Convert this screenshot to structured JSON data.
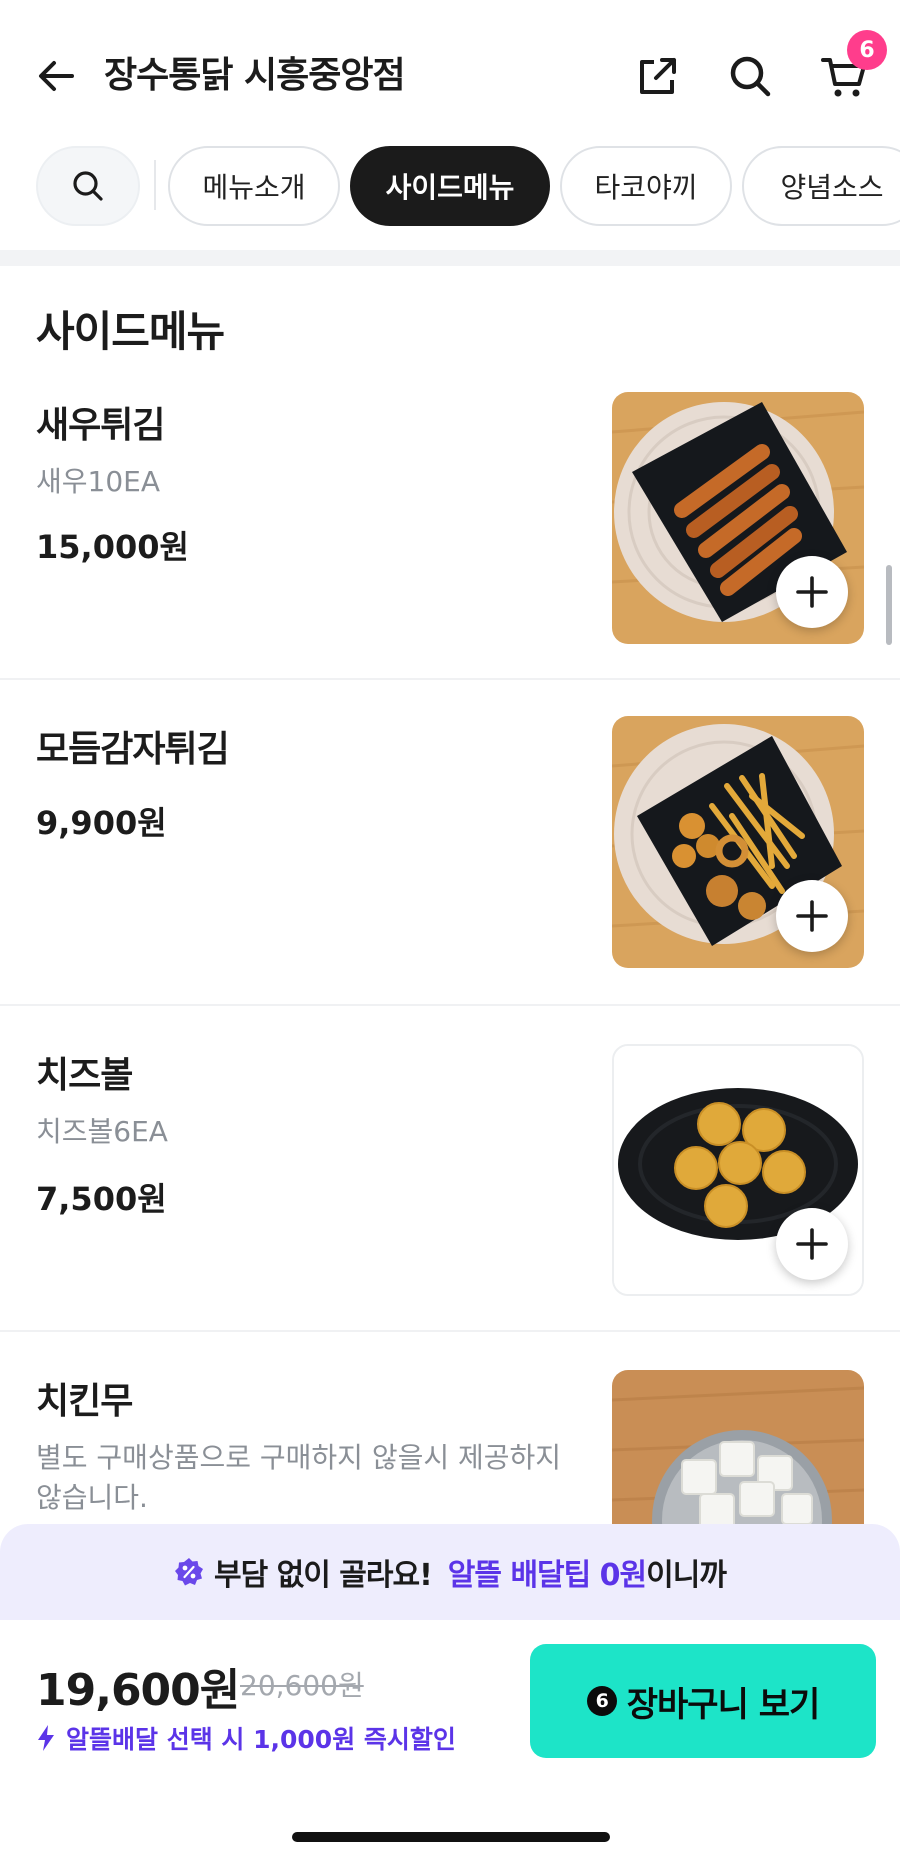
{
  "header": {
    "store_name": "장수통닭 시흥중앙점",
    "cart_count": "6"
  },
  "tabs": [
    {
      "label": "메뉴소개",
      "active": false
    },
    {
      "label": "사이드메뉴",
      "active": true
    },
    {
      "label": "타코야끼",
      "active": false
    },
    {
      "label": "양념소스",
      "active": false
    }
  ],
  "section": {
    "title": "사이드메뉴"
  },
  "items": [
    {
      "name": "새우튀김",
      "desc": "새우10EA",
      "price": "15,000원",
      "image": "fried-shrimp-photo"
    },
    {
      "name": "모듬감자튀김",
      "desc": "",
      "price": "9,900원",
      "image": "assorted-fries-photo"
    },
    {
      "name": "치즈볼",
      "desc": "치즈볼6EA",
      "price": "7,500원",
      "image": "cheese-balls-photo"
    },
    {
      "name": "치킨무",
      "desc": "별도 구매상품으로 구매하지 않을시  제공하지 않습니다.",
      "price": "",
      "image": "chicken-radish-photo"
    }
  ],
  "promo": {
    "text": "부담 없이 골라요!",
    "highlight": "알뜰 배달팁 0원",
    "suffix": "이니까"
  },
  "order": {
    "total": "19,600원",
    "original": "20,600원",
    "discount_text": "알뜰배달 선택 시 1,000원 즉시할인",
    "cta_label": "장바구니 보기",
    "cta_count": "6"
  },
  "colors": {
    "accent_purple": "#5b34e8",
    "cta_mint": "#1de4c8",
    "badge_pink": "#ff3d8c"
  }
}
